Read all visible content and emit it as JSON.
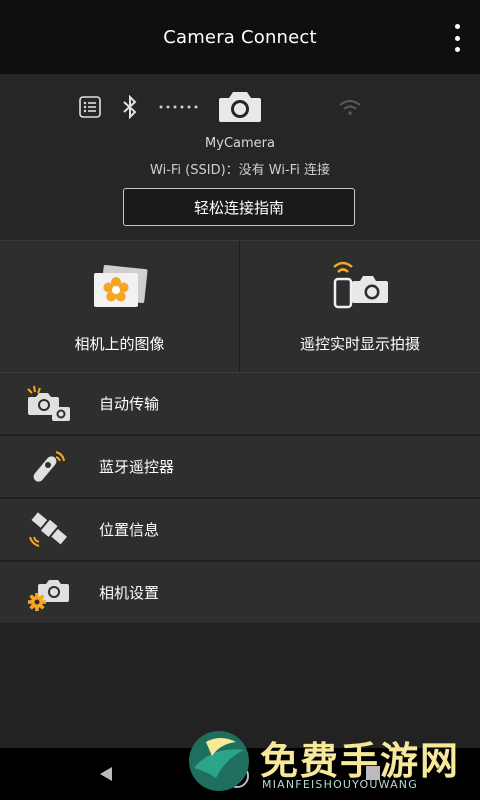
{
  "appbar": {
    "title": "Camera Connect",
    "menu_icon": "more-vert-icon"
  },
  "status": {
    "camera_name": "MyCamera",
    "ssid_text": "Wi-Fi (SSID)：没有 Wi-Fi 连接",
    "guide_button": "轻松连接指南",
    "icons": [
      "list-icon",
      "bluetooth-icon",
      "connection-dots-icon",
      "camera-icon",
      "wifi-icon"
    ]
  },
  "tiles": [
    {
      "label": "相机上的图像",
      "icon": "gallery-images-icon"
    },
    {
      "label": "遥控实时显示拍摄",
      "icon": "remote-live-view-icon"
    }
  ],
  "menu": [
    {
      "label": "自动传输",
      "icon": "auto-transfer-icon"
    },
    {
      "label": "蓝牙遥控器",
      "icon": "bluetooth-remote-icon"
    },
    {
      "label": "位置信息",
      "icon": "satellite-icon"
    },
    {
      "label": "相机设置",
      "icon": "camera-settings-icon"
    }
  ],
  "watermark": {
    "title": "免费手游网",
    "subtitle": "MIANFEISHOUYOUWANG"
  },
  "colors": {
    "bar": "#0f0f0f",
    "panel": "#2e2e2e",
    "accent_orange": "#f5a623",
    "watermark_gold": "#f7e89a"
  }
}
